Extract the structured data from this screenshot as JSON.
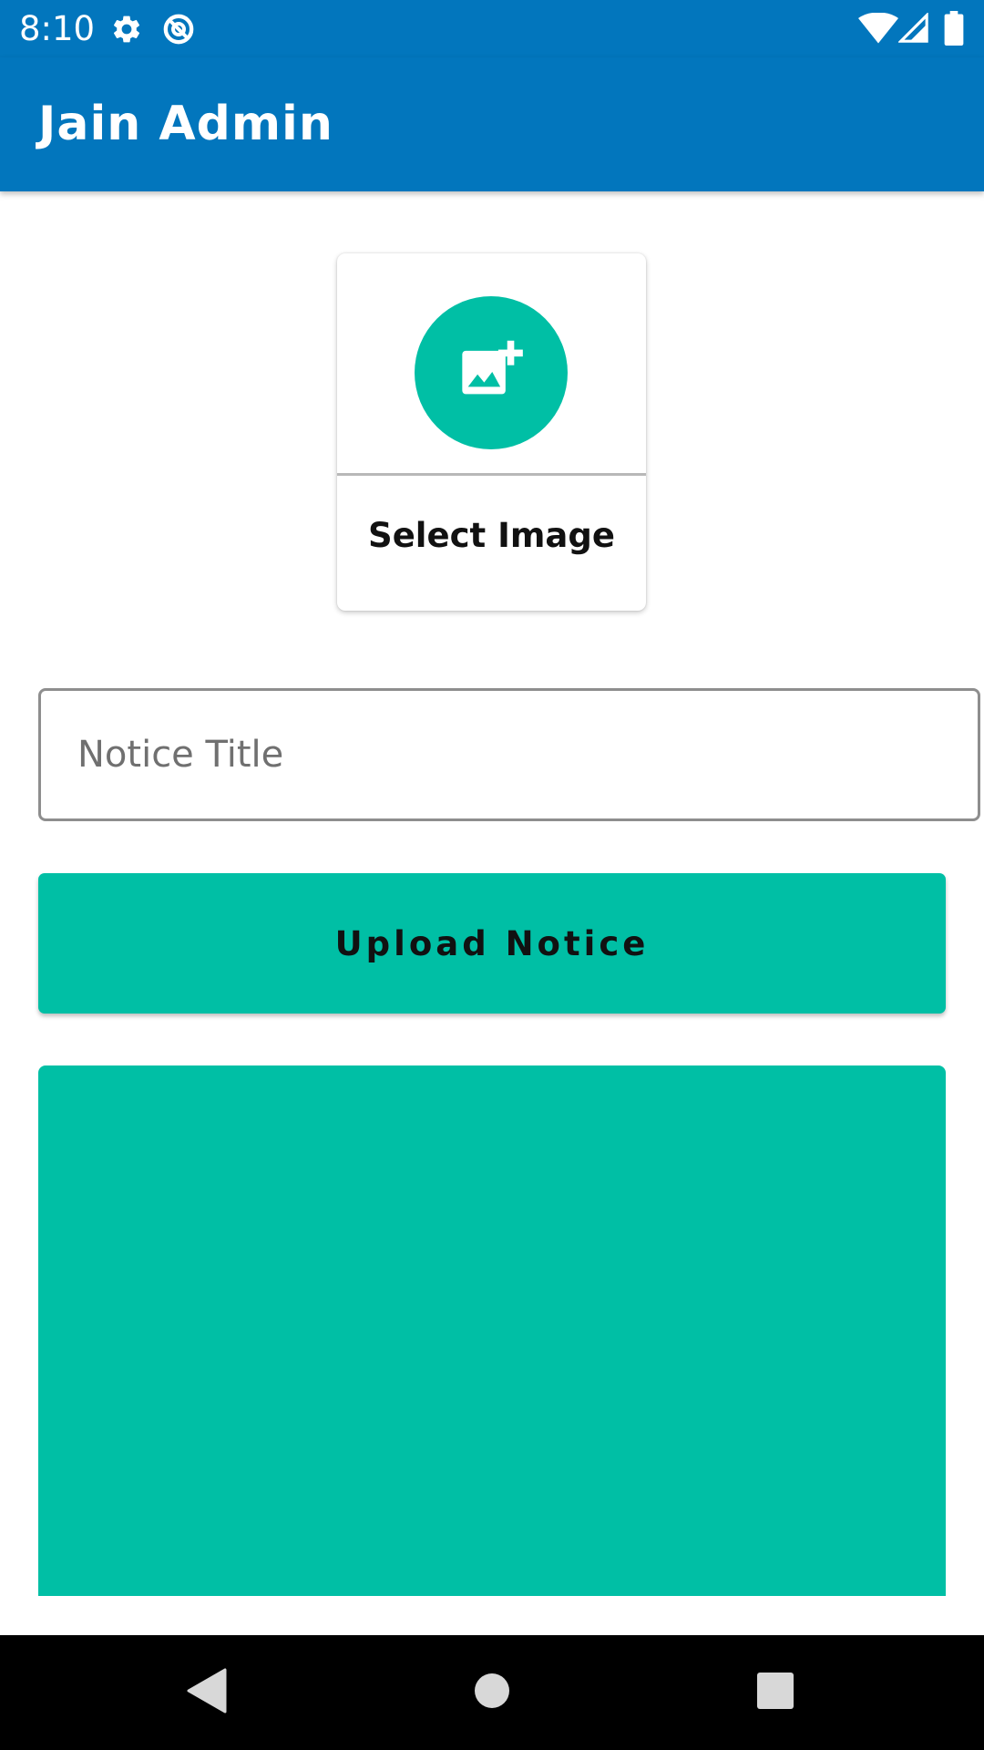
{
  "status_bar": {
    "time": "8:10",
    "icons_left": [
      "gear-icon",
      "data-saver-icon"
    ],
    "icons_right": [
      "wifi-icon",
      "cell-signal-icon",
      "battery-icon"
    ]
  },
  "app_bar": {
    "title": "Jain Admin"
  },
  "select_image_card": {
    "icon": "add-photo-icon",
    "label": "Select Image"
  },
  "notice_title_input": {
    "placeholder": "Notice Title",
    "value": ""
  },
  "upload_button": {
    "label": "Upload Notice"
  },
  "nav_bar": {
    "buttons": [
      "back-icon",
      "home-icon",
      "recents-icon"
    ]
  },
  "colors": {
    "primary": "#0276BD",
    "accent": "#00BFA5"
  }
}
